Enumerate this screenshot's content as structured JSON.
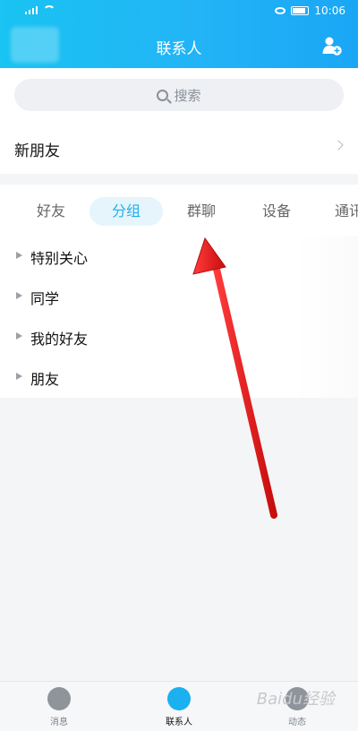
{
  "status_bar": {
    "time": "10:06"
  },
  "header": {
    "title": "联系人"
  },
  "search": {
    "placeholder": "搜索"
  },
  "new_friends": {
    "label": "新朋友"
  },
  "tabs": [
    {
      "label": "好友"
    },
    {
      "label": "分组",
      "active": true
    },
    {
      "label": "群聊"
    },
    {
      "label": "设备"
    },
    {
      "label": "通讯"
    }
  ],
  "groups": [
    {
      "label": "特别关心"
    },
    {
      "label": "同学"
    },
    {
      "label": "我的好友"
    },
    {
      "label": "朋友"
    }
  ],
  "bottom_nav": [
    {
      "label": "消息"
    },
    {
      "label": "联系人",
      "active": true
    },
    {
      "label": "动态"
    }
  ],
  "watermark": "Baidu经验",
  "colors": {
    "accent": "#23aee8",
    "arrow": "#e31b1b",
    "header_start": "#19c3f2",
    "header_end": "#1aa6f5"
  }
}
